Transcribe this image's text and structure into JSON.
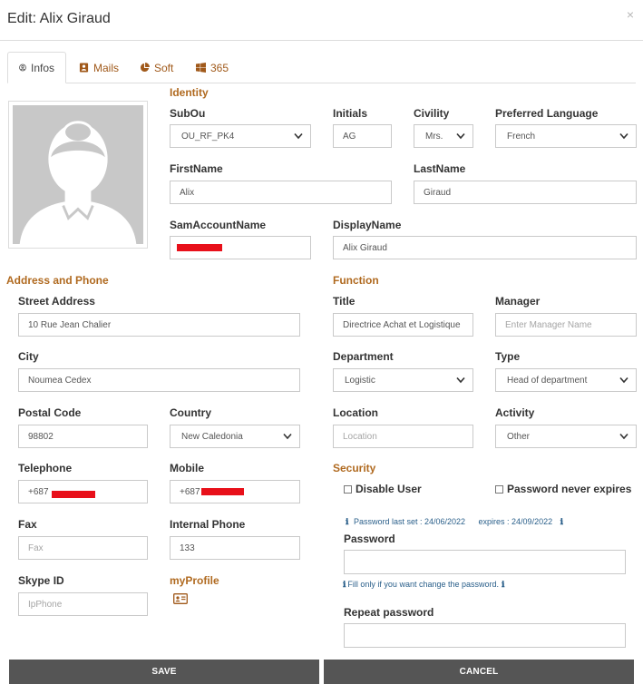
{
  "header": {
    "title": "Edit: Alix Giraud",
    "close": "×"
  },
  "tabs": [
    {
      "label": "Infos",
      "icon": "user-circle-icon"
    },
    {
      "label": "Mails",
      "icon": "contact-card-icon"
    },
    {
      "label": "Soft",
      "icon": "pie-chart-icon"
    },
    {
      "label": "365",
      "icon": "windows-logo-icon"
    }
  ],
  "identity": {
    "section": "Identity",
    "subou": {
      "label": "SubOu",
      "value": "OU_RF_PK4"
    },
    "initials": {
      "label": "Initials",
      "value": "AG"
    },
    "civility": {
      "label": "Civility",
      "value": "Mrs."
    },
    "language": {
      "label": "Preferred Language",
      "value": "French"
    },
    "firstname": {
      "label": "FirstName",
      "value": "Alix"
    },
    "lastname": {
      "label": "LastName",
      "value": "Giraud"
    },
    "sam": {
      "label": "SamAccountName",
      "value": ""
    },
    "displayname": {
      "label": "DisplayName",
      "value": "Alix Giraud"
    }
  },
  "address": {
    "section": "Address and Phone",
    "street": {
      "label": "Street Address",
      "value": "10 Rue Jean Chalier"
    },
    "city": {
      "label": "City",
      "value": "Noumea Cedex"
    },
    "postal": {
      "label": "Postal Code",
      "value": "98802"
    },
    "country": {
      "label": "Country",
      "value": "New Caledonia"
    },
    "telephone": {
      "label": "Telephone",
      "value": "+687"
    },
    "mobile": {
      "label": "Mobile",
      "value": "+687"
    },
    "fax": {
      "label": "Fax",
      "placeholder": "Fax"
    },
    "internal": {
      "label": "Internal Phone",
      "value": "133"
    },
    "skype": {
      "label": "Skype ID",
      "placeholder": "IpPhone"
    },
    "myprofile": {
      "label": "myProfile",
      "icon": "id-card-icon"
    }
  },
  "function": {
    "section": "Function",
    "title": {
      "label": "Title",
      "value": "Directrice Achat et Logistique"
    },
    "manager": {
      "label": "Manager",
      "placeholder": "Enter Manager Name"
    },
    "department": {
      "label": "Department",
      "value": "Logistic"
    },
    "type": {
      "label": "Type",
      "value": "Head of department"
    },
    "location": {
      "label": "Location",
      "placeholder": "Location"
    },
    "activity": {
      "label": "Activity",
      "value": "Other"
    }
  },
  "security": {
    "section": "Security",
    "disable_user": "Disable User",
    "never_expires": "Password never expires",
    "pwd_last_set": "Password last set : 24/06/2022",
    "expires": "expires : 24/09/2022",
    "password_label": "Password",
    "password_hint": "Fill only if you want change the password.",
    "repeat_label": "Repeat password"
  },
  "actions": {
    "save": "SAVE",
    "cancel": "CANCEL"
  },
  "colors": {
    "accent": "#b06a20",
    "tab_text": "#a0591a",
    "button_bg": "#555555",
    "redaction": "#e8101a",
    "info_text": "#2a5f8a"
  }
}
